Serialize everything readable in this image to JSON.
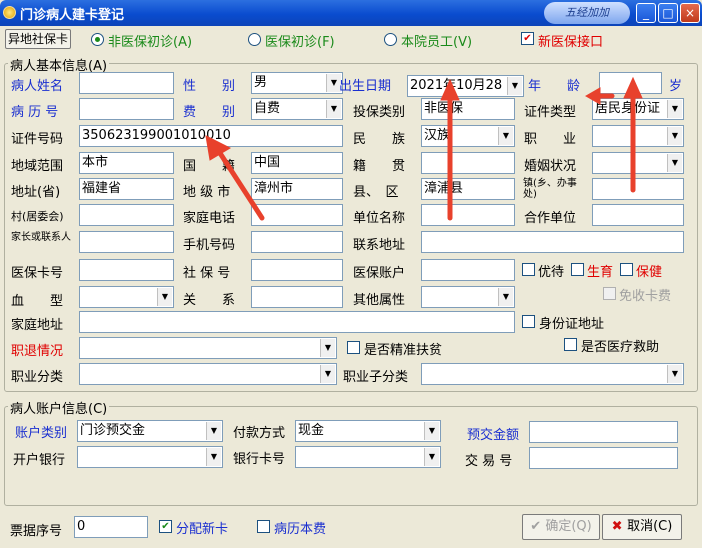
{
  "window": {
    "title": "门诊病人建卡登记",
    "deco_text": "五经加加",
    "min": "_",
    "max": "□",
    "close": "×"
  },
  "top": {
    "offsite_btn": "异地社保卡",
    "radio_non_insured": "非医保初诊(A)",
    "radio_insured": "医保初诊(F)",
    "radio_staff": "本院员工(V)",
    "new_interface": "新医保接口"
  },
  "patient_group": "病人基本信息(A)",
  "fields": {
    "name_label": "病人姓名",
    "name": "",
    "gender_label": "性　　别",
    "gender": "男",
    "dob_label": "出生日期",
    "dob": "2021年10月28",
    "age_label": "年　　龄",
    "age": "",
    "age_unit": "岁",
    "record_label": "病 历 号",
    "record": "",
    "fee_label": "费　　别",
    "fee": "自费",
    "ins_type_label": "投保类别",
    "ins_type": "非医保",
    "id_type_label": "证件类型",
    "id_type": "居民身份证",
    "id_no_label": "证件号码",
    "id_no": "350623199001010010",
    "ethnic_label": "民　　族",
    "ethnic": "汉族",
    "job_label": "职　　业",
    "job": "",
    "area_label": "地域范围",
    "area": "本市",
    "nation_label": "国　　籍",
    "nation": "中国",
    "origin_label": "籍　　贯",
    "origin": "",
    "marital_label": "婚姻状况",
    "marital": "",
    "prov_label": "地址(省)",
    "prov": "福建省",
    "city_label": "地 级 市",
    "city": "漳州市",
    "county_label": "县、　区",
    "county": "漳浦县",
    "town_label": "镇(乡、办事处)",
    "town": "",
    "village_label": "村(居委会)",
    "village": "",
    "home_phone_label": "家庭电话",
    "home_phone": "",
    "unit_label": "单位名称",
    "unit": "",
    "coop_label": "合作单位",
    "coop": "",
    "guardian_label": "家长或联系人",
    "guardian": "",
    "mobile_label": "手机号码",
    "mobile": "",
    "contact_addr_label": "联系地址",
    "contact_addr": "",
    "ins_card_label": "医保卡号",
    "ins_card": "",
    "soc_no_label": "社 保 号",
    "soc_no": "",
    "ins_acct_label": "医保账户",
    "ins_acct": "",
    "priority_label": "优待",
    "birth_label": "生育",
    "care_label": "保健",
    "blood_label": "血　　型",
    "blood": "",
    "relation_label": "关　　系",
    "relation": "",
    "other_label": "其他属性",
    "other": "",
    "free_card_label": "免收卡费",
    "home_addr_label": "家庭地址",
    "home_addr": "",
    "idcard_addr_label": "身份证地址",
    "retire_label": "职退情况",
    "retire": "",
    "poverty_label": "是否精准扶贫",
    "medical_aid_label": "是否医疗救助",
    "job_class_label": "职业分类",
    "job_class": "",
    "job_sub_label": "职业子分类",
    "job_sub": ""
  },
  "account_group": "病人账户信息(C)",
  "account": {
    "acct_type_label": "账户类别",
    "acct_type": "门诊预交金",
    "pay_label": "付款方式",
    "pay": "现金",
    "deposit_label": "预交金额",
    "deposit": "",
    "bank_label": "开户银行",
    "bank": "",
    "bank_card_label": "银行卡号",
    "bank_card": "",
    "trade_label": "交 易 号",
    "trade": ""
  },
  "footer": {
    "receipt_label": "票据序号",
    "receipt": "0",
    "assign_card": "分配新卡",
    "record_fee": "病历本费",
    "ok": "确定(Q)",
    "cancel": "取消(C)"
  },
  "colors": {
    "title_bar": "#0a4ccf",
    "blue_label": "#1a2fd0",
    "red_label": "#e00000",
    "arrow": "#e8412c"
  }
}
